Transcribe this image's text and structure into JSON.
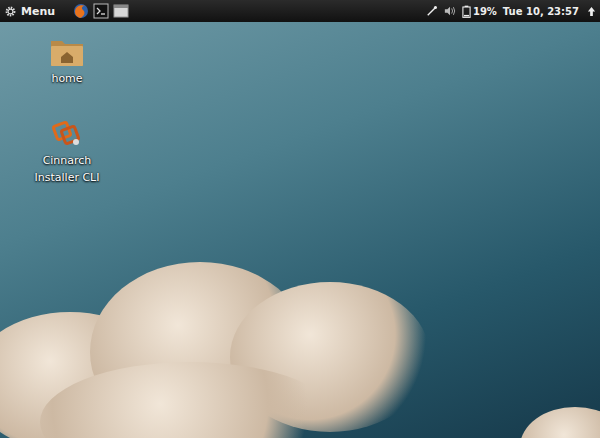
{
  "panel": {
    "menu": {
      "label": "Menu"
    },
    "launchers": [
      {
        "name": "Web Browser"
      },
      {
        "name": "Terminal"
      },
      {
        "name": "Files"
      }
    ],
    "tray": {
      "battery": {
        "reading": "19%",
        "level": 0.19
      },
      "clock": "Tue 10, 23:57"
    }
  },
  "desktop_icons": [
    {
      "label": "home",
      "kind": "folder"
    },
    {
      "label": "Cinnarch Installer CLI",
      "kind": "installer"
    }
  ]
}
